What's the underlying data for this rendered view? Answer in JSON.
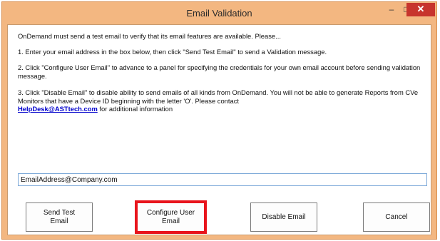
{
  "window": {
    "title": "Email Validation",
    "min_glyph": "–",
    "max_glyph": "□",
    "close_glyph": "✕"
  },
  "body": {
    "intro": "OnDemand must send a test email to verify that its email features are available. Please...",
    "step1": "1. Enter your email address in the box below, then click \"Send Test Email\" to send a Validation message.",
    "step2": "2. Click \"Configure User Email\" to advance to a panel for specifying the credentials for your own email account before sending validation message.",
    "step3_text": "3. Click \"Disable Email\" to disable ability to send emails of all kinds from OnDemand. You will not be able to generate Reports from CVe Monitors that have a Device ID beginning with the letter 'O'. Please contact",
    "step3_link": "HelpDesk@ASTtech.com",
    "step3_suffix": " for additional information"
  },
  "email_input": {
    "value": "EmailAddress@Company.com"
  },
  "buttons": {
    "send_test_line1": "Send Test",
    "send_test_line2": "Email",
    "configure_line1": "Configure User",
    "configure_line2": "Email",
    "disable": "Disable Email",
    "cancel": "Cancel"
  },
  "colors": {
    "title_bar": "#f3b781",
    "close_button": "#c7342d",
    "highlight_box": "#e8141c",
    "link": "#0000cc"
  }
}
